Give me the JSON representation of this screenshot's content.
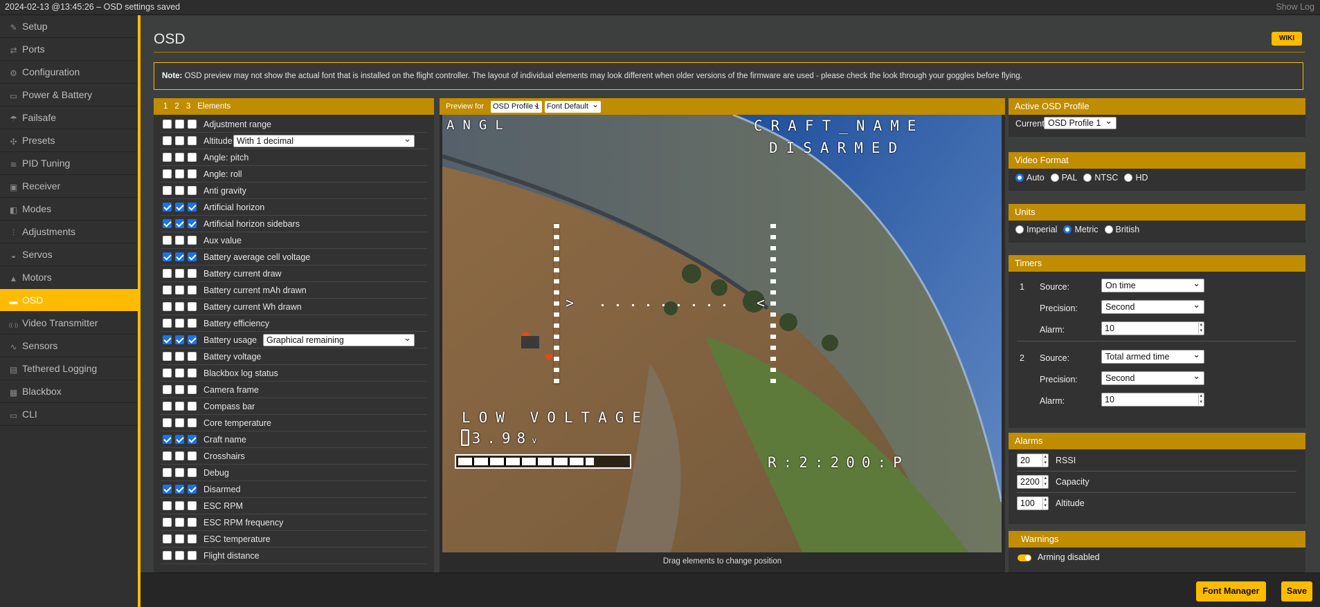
{
  "topbar": {
    "log": "2024-02-13 @13:45:26 – OSD settings saved",
    "show_log": "Show Log"
  },
  "sidebar": {
    "items": [
      {
        "label": "Setup",
        "icon": "wrench-icon",
        "glyph": "✎"
      },
      {
        "label": "Ports",
        "icon": "plug-icon",
        "glyph": "⇄"
      },
      {
        "label": "Configuration",
        "icon": "gear-icon",
        "glyph": "⚙"
      },
      {
        "label": "Power & Battery",
        "icon": "battery-icon",
        "glyph": "▭"
      },
      {
        "label": "Failsafe",
        "icon": "parachute-icon",
        "glyph": "☂"
      },
      {
        "label": "Presets",
        "icon": "puzzle-icon",
        "glyph": "✣"
      },
      {
        "label": "PID Tuning",
        "icon": "tuning-icon",
        "glyph": "≋"
      },
      {
        "label": "Receiver",
        "icon": "receiver-icon",
        "glyph": "▣"
      },
      {
        "label": "Modes",
        "icon": "modes-icon",
        "glyph": "◧"
      },
      {
        "label": "Adjustments",
        "icon": "sliders-icon",
        "glyph": "⫶"
      },
      {
        "label": "Servos",
        "icon": "servo-icon",
        "glyph": "◒"
      },
      {
        "label": "Motors",
        "icon": "motor-icon",
        "glyph": "▲"
      },
      {
        "label": "OSD",
        "icon": "osd-icon",
        "glyph": "▬"
      },
      {
        "label": "Video Transmitter",
        "icon": "antenna-icon",
        "glyph": "((·))"
      },
      {
        "label": "Sensors",
        "icon": "pulse-icon",
        "glyph": "∿"
      },
      {
        "label": "Tethered Logging",
        "icon": "log-icon",
        "glyph": "▤"
      },
      {
        "label": "Blackbox",
        "icon": "blackbox-icon",
        "glyph": "▦"
      },
      {
        "label": "CLI",
        "icon": "terminal-icon",
        "glyph": "▭"
      }
    ],
    "active": "OSD"
  },
  "page": {
    "title": "OSD",
    "wiki": "WIKI",
    "note_bold": "Note:",
    "note_text": " OSD preview may not show the actual font that is installed on the flight controller. The layout of individual elements may look different when older versions of the firmware are used - please check the look through your goggles before flying."
  },
  "elements": {
    "header": {
      "p1": "1",
      "p2": "2",
      "p3": "3",
      "title": "Elements"
    },
    "rows": [
      {
        "label": "Adjustment range",
        "on": false
      },
      {
        "label": "Altitude",
        "on": false,
        "select": "With 1 decimal"
      },
      {
        "label": "Angle: pitch",
        "on": false
      },
      {
        "label": "Angle: roll",
        "on": false
      },
      {
        "label": "Anti gravity",
        "on": false
      },
      {
        "label": "Artificial horizon",
        "on": true
      },
      {
        "label": "Artificial horizon sidebars",
        "on": true
      },
      {
        "label": "Aux value",
        "on": false
      },
      {
        "label": "Battery average cell voltage",
        "on": true
      },
      {
        "label": "Battery current draw",
        "on": false
      },
      {
        "label": "Battery current mAh drawn",
        "on": false
      },
      {
        "label": "Battery current Wh drawn",
        "on": false
      },
      {
        "label": "Battery efficiency",
        "on": false
      },
      {
        "label": "Battery usage",
        "on": true,
        "select": "Graphical remaining"
      },
      {
        "label": "Battery voltage",
        "on": false
      },
      {
        "label": "Blackbox log status",
        "on": false
      },
      {
        "label": "Camera frame",
        "on": false
      },
      {
        "label": "Compass bar",
        "on": false
      },
      {
        "label": "Core temperature",
        "on": false
      },
      {
        "label": "Craft name",
        "on": true
      },
      {
        "label": "Crosshairs",
        "on": false
      },
      {
        "label": "Debug",
        "on": false
      },
      {
        "label": "Disarmed",
        "on": true
      },
      {
        "label": "ESC RPM",
        "on": false
      },
      {
        "label": "ESC RPM frequency",
        "on": false
      },
      {
        "label": "ESC temperature",
        "on": false
      },
      {
        "label": "Flight distance",
        "on": false
      }
    ]
  },
  "preview": {
    "label": "Preview for",
    "profile": "OSD Profile 1",
    "font": "Font Default",
    "drag_hint": "Drag elements to change position",
    "osd": {
      "angl": "ANGL",
      "craft_name": "CRAFT_NAME",
      "disarmed": "DISARMED",
      "low_voltage": "LOW VOLTAGE",
      "voltage": "3.98",
      "voltage_unit": "v",
      "rssi_text": "R:2:200:P",
      "battery_remaining": 0.8
    }
  },
  "active_profile": {
    "title": "Active OSD Profile",
    "current_label": "Current:",
    "value": "OSD Profile 1"
  },
  "video_format": {
    "title": "Video Format",
    "options": [
      "Auto",
      "PAL",
      "NTSC",
      "HD"
    ],
    "selected": "Auto"
  },
  "units": {
    "title": "Units",
    "options": [
      "Imperial",
      "Metric",
      "British"
    ],
    "selected": "Metric"
  },
  "timers": {
    "title": "Timers",
    "source_label": "Source:",
    "precision_label": "Precision:",
    "alarm_label": "Alarm:",
    "items": [
      {
        "num": "1",
        "source": "On time",
        "precision": "Second",
        "alarm": "10"
      },
      {
        "num": "2",
        "source": "Total armed time",
        "precision": "Second",
        "alarm": "10"
      }
    ]
  },
  "alarms": {
    "title": "Alarms",
    "items": [
      {
        "value": "20",
        "label": "RSSI"
      },
      {
        "value": "2200",
        "label": "Capacity"
      },
      {
        "value": "100",
        "label": "Altitude"
      }
    ]
  },
  "warnings": {
    "title": "Warnings",
    "items": [
      {
        "label": "Arming disabled",
        "on": true
      }
    ]
  },
  "footer": {
    "font_manager": "Font Manager",
    "save": "Save"
  },
  "colors": {
    "accent": "#ffbb00",
    "panel_header": "#c08c00",
    "checkbox": "#1a73e8"
  }
}
